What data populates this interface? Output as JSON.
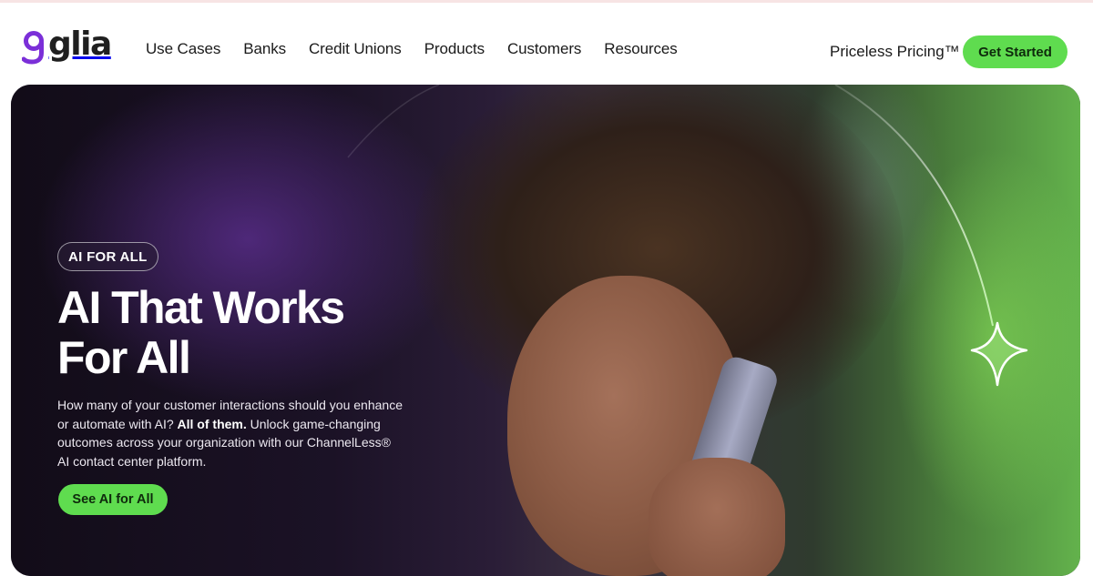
{
  "header": {
    "logo_text": "glia",
    "nav": [
      "Use Cases",
      "Banks",
      "Credit Unions",
      "Products",
      "Customers",
      "Resources"
    ],
    "pricing_label": "Priceless Pricing™",
    "cta_label": "Get Started"
  },
  "hero": {
    "badge": "AI FOR ALL",
    "title_line1": "AI That Works",
    "title_line2": "For All",
    "desc_part1": "How many of your customer interactions should you enhance or automate with AI? ",
    "desc_bold": "All of them.",
    "desc_part2": " Unlock game-changing outcomes across your organization with our ChannelLess® AI contact center platform.",
    "cta_label": "See AI for All",
    "photo_icon": "woman-on-phone-photo",
    "sparkle_icon": "sparkle-star-icon"
  },
  "colors": {
    "brand_purple": "#7b2fd8",
    "accent_green": "#5fdc4f",
    "hero_dark": "#17111e"
  }
}
